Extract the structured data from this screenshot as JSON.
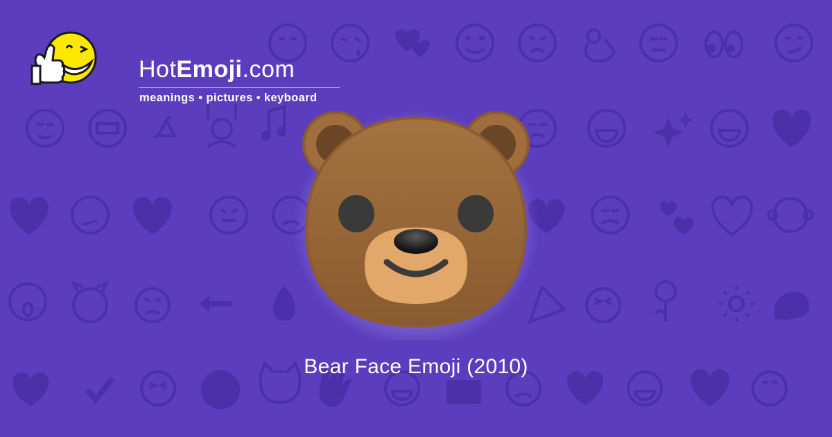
{
  "site": {
    "name_light": "Hot",
    "name_bold": "Emoji",
    "name_suffix": ".com",
    "tagline": "meanings • pictures • keyboard",
    "mascot_icon": "thumbs-up-winking-face-icon"
  },
  "hero": {
    "emoji_icon": "bear-face-icon",
    "title": "Bear Face Emoji (2010)"
  },
  "theme": {
    "background": "#5b3dbd",
    "pattern_color": "#4a2fa8",
    "glow": "#b9a6ff",
    "bear_fur": "#9e6a3e",
    "bear_ear_inner": "#6a4526",
    "bear_muzzle": "#e2a86a",
    "bear_features": "#3a3a3a"
  },
  "background_icons": [
    "winking-kiss-face-icon",
    "two-hearts-icon",
    "smiling-face-icon",
    "persevering-face-icon",
    "ok-hand-icon",
    "relieved-face-icon",
    "eyes-icon",
    "smirking-face-icon",
    "relieved-face-icon",
    "grimacing-face-icon",
    "recycle-icon",
    "raising-hands-person-icon",
    "musical-notes-icon",
    "sleepy-face-icon",
    "grinning-face-icon",
    "sparkles-icon",
    "smiling-face-icon",
    "striped-heart-icon",
    "broken-heart-icon",
    "confused-face-icon",
    "striped-heart-icon",
    "tongue-face-icon",
    "sad-face-icon",
    "heart-arrow-icon",
    "weary-face-icon",
    "revolving-hearts-icon",
    "heart-icon",
    "monkey-icon",
    "screaming-face-icon",
    "devil-face-icon",
    "angry-face-icon",
    "left-arrow-icon",
    "fire-icon",
    "party-popper-icon",
    "squinting-tongue-face-icon",
    "rose-icon",
    "sun-icon",
    "flexed-biceps-icon",
    "striped-heart-icon",
    "check-mark-icon",
    "grinning-squint-face-icon",
    "full-moon-face-icon",
    "heart-eyes-cat-icon",
    "waving-hand-icon",
    "grinning-face-icon",
    "camera-icon",
    "disappointed-face-icon",
    "striped-heart-icon",
    "joy-face-icon",
    "beating-heart-icon",
    "kissing-face-icon"
  ]
}
